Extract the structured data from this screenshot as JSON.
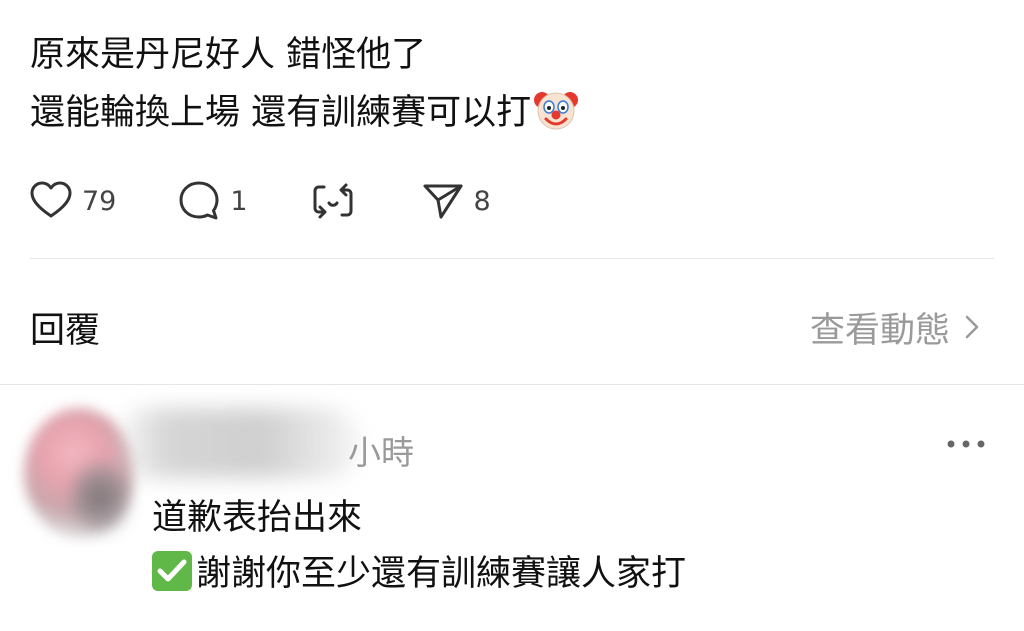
{
  "post": {
    "line1": "原來是丹尼好人 錯怪他了",
    "line2": "還能輪換上場 還有訓練賽可以打",
    "emoji": "clown-face-emoji"
  },
  "actions": {
    "likes": "79",
    "comments": "1",
    "shares": "8"
  },
  "replies": {
    "title": "回覆",
    "view_activity": "查看動態"
  },
  "reply": {
    "time": "小時",
    "line1": "道歉表抬出來",
    "line2": "謝謝你至少還有訓練賽讓人家打",
    "emoji": "check-mark-button-emoji"
  },
  "icons": {
    "like": "heart-icon",
    "comment": "comment-bubble-icon",
    "repost": "repost-icon",
    "share": "send-icon",
    "chevron": "chevron-right-icon",
    "more": "more-options-icon"
  },
  "colors": {
    "text": "#111111",
    "muted": "#9a9a9a",
    "divider": "#e6e6e6",
    "check_green": "#5fb848"
  }
}
